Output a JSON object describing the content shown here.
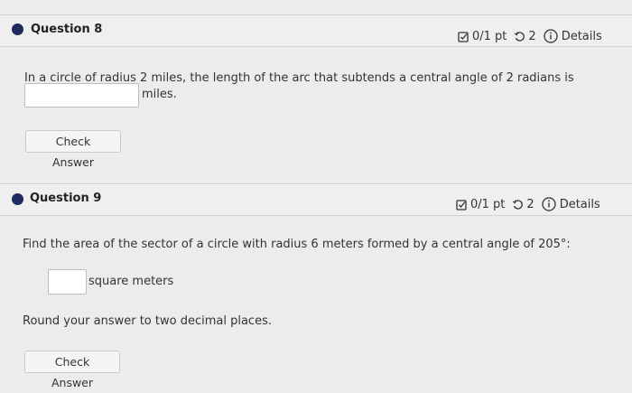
{
  "questions": [
    {
      "title": "Question 8",
      "score": "0/1 pt",
      "attempts": "2",
      "details_label": "Details",
      "prompt_line1": "In a circle of radius 2 miles, the length of the arc that subtends a central angle of 2 radians is",
      "answer_value": "",
      "answer_suffix": "miles.",
      "check_label": "Check Answer"
    },
    {
      "title": "Question 9",
      "score": "0/1 pt",
      "attempts": "2",
      "details_label": "Details",
      "prompt_line1": "Find the area of the sector of a circle with radius 6 meters formed by a central angle of 205°:",
      "answer_value": "",
      "answer_suffix": "square meters",
      "instruction": "Round your answer to two decimal places.",
      "check_label": "Check Answer"
    }
  ],
  "colors": {
    "status_dot": "#1f2a5e",
    "background": "#ececec"
  },
  "icons": {
    "score": "checkbox-edit-icon",
    "attempts": "retry-icon",
    "details": "info-circle-icon"
  }
}
